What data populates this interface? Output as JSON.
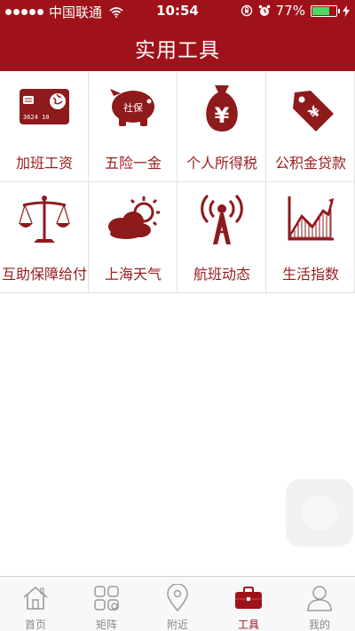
{
  "status_bar": {
    "carrier": "中国联通",
    "time": "10:54",
    "battery": "77%",
    "battery_level": 0.77
  },
  "header": {
    "title": "实用工具"
  },
  "tools": [
    {
      "label": "加班工资",
      "icon": "bank-card-icon"
    },
    {
      "label": "五险一金",
      "icon": "piggy-bank-icon",
      "badge": "社保"
    },
    {
      "label": "个人所得税",
      "icon": "money-bag-icon",
      "badge": "¥"
    },
    {
      "label": "公积金贷款",
      "icon": "price-tag-icon",
      "badge": "¥"
    },
    {
      "label": "互助保障给付",
      "icon": "balance-scale-icon"
    },
    {
      "label": "上海天气",
      "icon": "weather-icon"
    },
    {
      "label": "航班动态",
      "icon": "radio-tower-icon"
    },
    {
      "label": "生活指数",
      "icon": "line-chart-icon"
    }
  ],
  "tab_bar": {
    "items": [
      {
        "label": "首页",
        "icon": "home-icon"
      },
      {
        "label": "矩阵",
        "icon": "grid-icon"
      },
      {
        "label": "附近",
        "icon": "location-pin-icon"
      },
      {
        "label": "工具",
        "icon": "toolbox-icon",
        "active": true
      },
      {
        "label": "我的",
        "icon": "user-icon"
      }
    ]
  },
  "colors": {
    "brand": "#a0121a",
    "icon": "#8e1a1c",
    "tab_inactive": "#8a8a8a"
  }
}
